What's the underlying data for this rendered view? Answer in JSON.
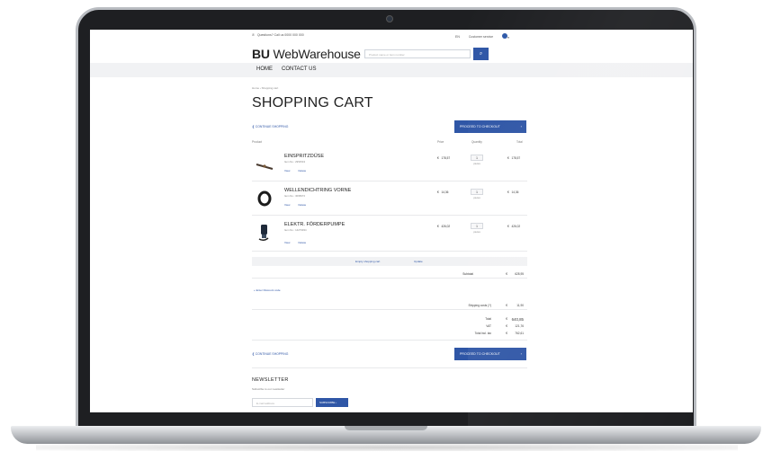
{
  "topbar": {
    "phone": "Questions? Call us 0000 000 000",
    "language": "EN",
    "customer_service": "Customer service",
    "account": "▾"
  },
  "header": {
    "logo_bold": "BU",
    "logo_rest": "WebWarehouse",
    "search_placeholder": "Product name or item number",
    "search_icon": "search-icon"
  },
  "nav": {
    "home": "HOME",
    "contact": "CONTACT US"
  },
  "breadcrumb": "Home › Shopping cart",
  "page_title": "SHOPPING CART",
  "continue_label": "❮ CONTINUE SHOPPING",
  "checkout_label": "PROCEED TO CHECKOUT",
  "columns": {
    "product": "Product",
    "price": "Price",
    "quantity": "Quantity",
    "total": "Total"
  },
  "items": [
    {
      "name": "EINSPRITZDÜSE",
      "item_no": "Item No.: 2954543",
      "view": "View",
      "delete": "Delete",
      "currency": "€",
      "price": "178,57",
      "qty": "1",
      "unit": "pieces",
      "total": "178,57",
      "icon": "nozzle-icon"
    },
    {
      "name": "WELLENDICHTRING VORNE",
      "item_no": "Item No.: 3095672",
      "view": "View",
      "delete": "Delete",
      "currency": "€",
      "price": "14,36",
      "qty": "1",
      "unit": "pieces",
      "total": "14,36",
      "icon": "seal-ring-icon"
    },
    {
      "name": "ELEKTR. FÖRDERPUMPE",
      "item_no": "Item No.: 14279934",
      "view": "View",
      "delete": "Delete",
      "currency": "€",
      "price": "426,02",
      "qty": "1",
      "unit": "pieces",
      "total": "426,02",
      "icon": "pump-icon"
    }
  ],
  "cart_actions": {
    "empty": "Empty shopping cart",
    "update": "Update"
  },
  "subtotal": {
    "label": "Subtotal",
    "currency": "€",
    "value": "628,95"
  },
  "discount_link": "+ Enter Discount code",
  "shipping": {
    "label": "Shipping costs (?)",
    "currency": "€",
    "value": "11,90"
  },
  "totals": [
    {
      "label": "Total",
      "currency": "€",
      "value": "640,85"
    },
    {
      "label": "VAT",
      "currency": "€",
      "value": "121,76"
    },
    {
      "label": "Total incl. tax",
      "currency": "€",
      "value": "762,61"
    }
  ],
  "newsletter": {
    "title": "NEWSLETTER",
    "subtitle": "Subscribe to our newsletter",
    "placeholder": "E-mail address",
    "button": "SUBSCRIBE"
  },
  "colors": {
    "accent": "#2f56a6",
    "frame": "#1e1f22",
    "nav_bg": "#f1f2f4"
  }
}
